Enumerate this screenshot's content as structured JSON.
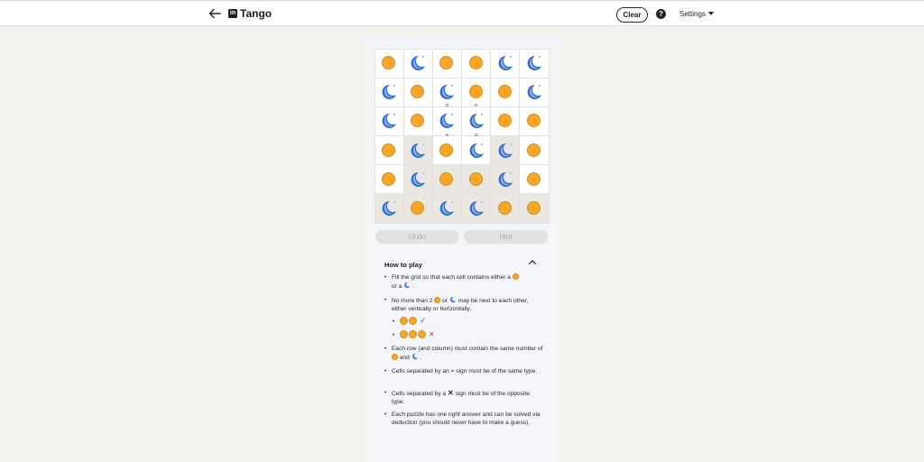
{
  "header": {
    "title": "Tango",
    "logo_text": "in",
    "clear_label": "Clear",
    "help_label": "?",
    "settings_label": "Settings"
  },
  "board": {
    "size": 6,
    "cells": [
      [
        "sun",
        "moon",
        "sun",
        "sun",
        "moon",
        "moon"
      ],
      [
        "moon",
        "sun",
        "moon",
        "sun",
        "sun",
        "moon"
      ],
      [
        "moon",
        "sun",
        "moon",
        "moon",
        "sun",
        "sun"
      ],
      [
        "sun",
        "moon",
        "sun",
        "moon",
        "moon",
        "sun"
      ],
      [
        "sun",
        "moon",
        "sun",
        "sun",
        "moon",
        "sun"
      ],
      [
        "moon",
        "sun",
        "moon",
        "moon",
        "sun",
        "sun"
      ]
    ],
    "locked": [
      [
        false,
        false,
        false,
        false,
        false,
        false
      ],
      [
        false,
        false,
        false,
        false,
        false,
        false
      ],
      [
        false,
        false,
        false,
        false,
        false,
        false
      ],
      [
        false,
        true,
        false,
        false,
        true,
        false
      ],
      [
        false,
        true,
        true,
        true,
        true,
        false
      ],
      [
        true,
        true,
        true,
        true,
        true,
        true
      ]
    ],
    "signs": [
      {
        "row": 1,
        "col": 2,
        "edge": "bottom",
        "symbol": "="
      },
      {
        "row": 1,
        "col": 3,
        "edge": "bottom",
        "symbol": "×"
      },
      {
        "row": 2,
        "col": 2,
        "edge": "bottom",
        "symbol": "×"
      },
      {
        "row": 2,
        "col": 3,
        "edge": "bottom",
        "symbol": "="
      }
    ]
  },
  "buttons": {
    "undo_label": "Undo",
    "hint_label": "Hint"
  },
  "how_to_play": {
    "title": "How to play",
    "rule1_a": "Fill the grid so that each cell contains either a",
    "rule1_b": "or a",
    "rule1_c": ".",
    "rule2_a": "No more than 2",
    "rule2_b": "or",
    "rule2_c": "may be next to each other, either vertically or horizontally.",
    "example_ok": "✓",
    "example_bad": "✕",
    "rule3_a": "Each row (and column) must contain the same number of",
    "rule3_b": "and",
    "rule3_c": ".",
    "rule4": "Cells separated by an = sign must be of the same type.",
    "rule5_a": "Cells separated by a",
    "rule5_sym": "✕",
    "rule5_b": "sign must be of the opposite type.",
    "rule6": "Each puzzle has one right answer and can be solved via deduction (you should never have to make a guess).",
    "bullet": "•"
  },
  "colors": {
    "sun": "#f7a826",
    "moon": "#2f6fd1",
    "check": "#2e8b3d",
    "cross": "#d0342c",
    "background": "#f3f2ef"
  }
}
